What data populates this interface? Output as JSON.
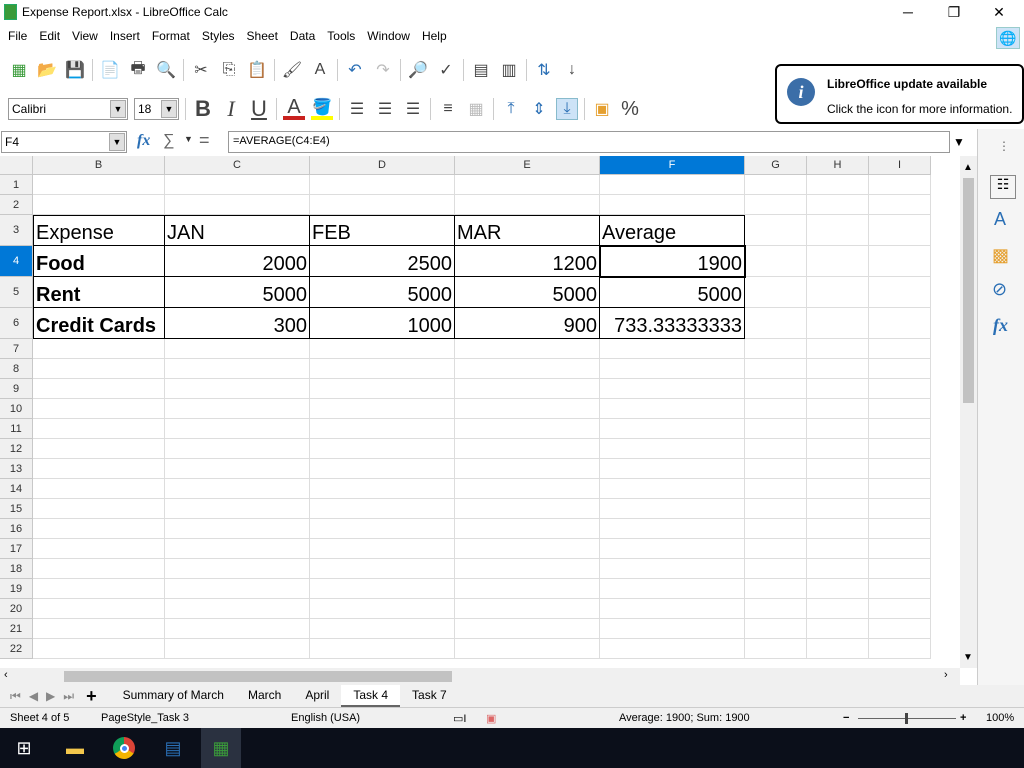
{
  "window": {
    "title": "Expense Report.xlsx - LibreOffice Calc",
    "minimize": "─",
    "maximize": "❐",
    "close": "✕"
  },
  "menu": [
    "File",
    "Edit",
    "View",
    "Insert",
    "Format",
    "Styles",
    "Sheet",
    "Data",
    "Tools",
    "Window",
    "Help"
  ],
  "toolbar": {
    "font_name": "Calibri",
    "font_size": "18",
    "bold": "B",
    "italic": "I",
    "underline": "U",
    "font_color": "A",
    "percent": "%",
    "font_color_hex": "#c9211e",
    "highlight_hex": "#ffff00"
  },
  "notification": {
    "title": "LibreOffice update available",
    "body": "Click the icon for more information."
  },
  "formula": {
    "name_box": "F4",
    "fx": "fx",
    "sum": "∑",
    "equals": "=",
    "content": "=AVERAGE(C4:E4)"
  },
  "columns": [
    "B",
    "C",
    "D",
    "E",
    "F",
    "G",
    "H",
    "I"
  ],
  "selected_column": "F",
  "selected_row": "4",
  "rows": [
    "1",
    "2",
    "3",
    "4",
    "5",
    "6",
    "7",
    "8",
    "9",
    "10",
    "11",
    "12",
    "13",
    "14",
    "15",
    "16",
    "17",
    "18",
    "19",
    "20",
    "21",
    "22"
  ],
  "table": [
    [
      "Expense",
      "JAN",
      "FEB",
      "MAR",
      "Average"
    ],
    [
      "Food",
      "2000",
      "2500",
      "1200",
      "1900"
    ],
    [
      "Rent",
      "5000",
      "5000",
      "5000",
      "5000"
    ],
    [
      "Credit Cards",
      "300",
      "1000",
      "900",
      "733.33333333"
    ]
  ],
  "sheet_tabs": [
    "Summary of March",
    "March",
    "April",
    "Task 4",
    "Task 7"
  ],
  "active_tab": "Task 4",
  "status": {
    "sheet": "Sheet 4 of 5",
    "page_style": "PageStyle_Task 3",
    "language": "English (USA)",
    "summary": "Average: 1900; Sum: 1900",
    "zoom": "100%"
  },
  "accent": "#0078d7"
}
